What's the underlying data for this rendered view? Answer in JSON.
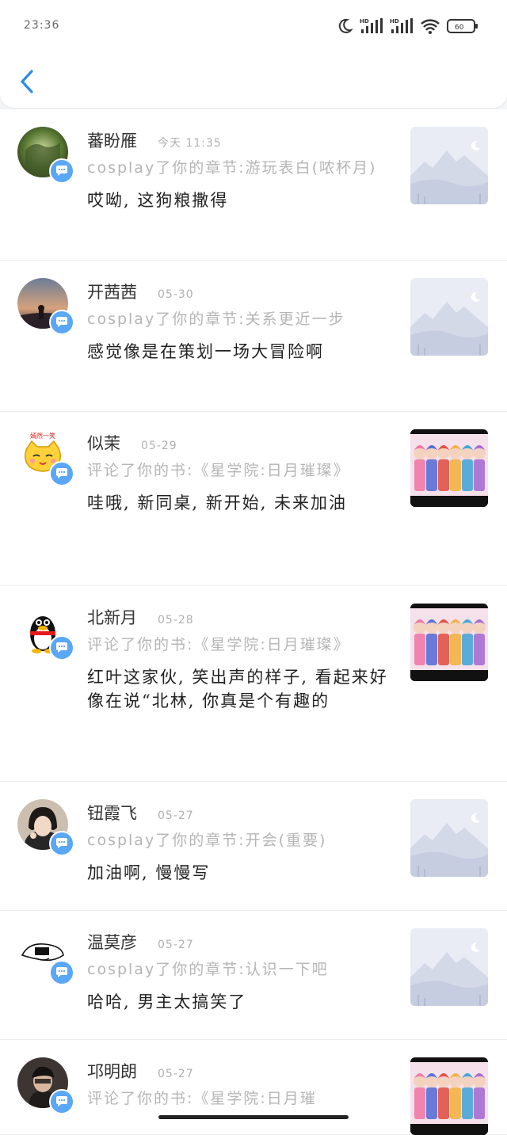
{
  "status_bar": {
    "time": "23:36",
    "battery": "60",
    "hd1": "HD",
    "hd2": "HD"
  },
  "notifications": [
    {
      "name": "蕃盼雁",
      "date": "今天 11:35",
      "description": "cosplay了你的章节:游玩表白(哝杯月)",
      "comment": "哎呦, 这狗粮撒得",
      "thumb": "landscape",
      "avatar": "green"
    },
    {
      "name": "开茜茜",
      "date": "05-30",
      "description": "cosplay了你的章节:关系更近一步",
      "comment": "感觉像是在策划一场大冒险啊",
      "thumb": "landscape",
      "avatar": "sunset"
    },
    {
      "name": "似茉",
      "date": "05-29",
      "description": "评论了你的书:《星学院:日月璀璨》",
      "comment": "哇哦, 新同桌, 新开始, 未来加油",
      "thumb": "anime",
      "avatar": "cat",
      "avatar_text": "嫣然一笑"
    },
    {
      "name": "北新月",
      "date": "05-28",
      "description": "评论了你的书:《星学院:日月璀璨》",
      "comment": "红叶这家伙, 笑出声的样子, 看起来好像在说“北林, 你真是个有趣的",
      "thumb": "anime",
      "avatar": "penguin"
    },
    {
      "name": "钮霞飞",
      "date": "05-27",
      "description": "cosplay了你的章节:开会(重要)",
      "comment": "加油啊, 慢慢写",
      "thumb": "landscape",
      "avatar": "girl"
    },
    {
      "name": "温莫彦",
      "date": "05-27",
      "description": "cosplay了你的章节:认识一下吧",
      "comment": "哈哈, 男主太搞笑了",
      "thumb": "landscape",
      "avatar": "sketch"
    },
    {
      "name": "邛明朗",
      "date": "05-27",
      "description": "评论了你的书:《星学院:日月璀",
      "comment": "",
      "thumb": "anime",
      "avatar": "dark"
    }
  ]
}
